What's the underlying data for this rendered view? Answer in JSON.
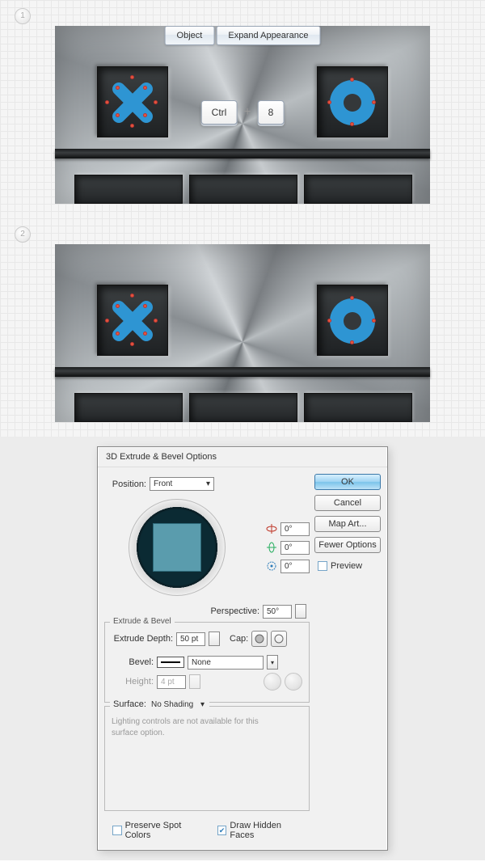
{
  "step1": {
    "badge": "1"
  },
  "step2": {
    "badge": "2"
  },
  "menu": {
    "object": "Object",
    "expand_appearance": "Expand Appearance"
  },
  "shortcut": {
    "key_ctrl": "Ctrl",
    "plus": "+",
    "key_8": "8"
  },
  "dialog": {
    "title": "3D Extrude & Bevel Options",
    "position_label": "Position:",
    "position_value": "Front",
    "rot_x": "0°",
    "rot_y": "0°",
    "rot_z": "0°",
    "perspective_label": "Perspective:",
    "perspective_value": "50°",
    "section_extrude": "Extrude & Bevel",
    "extrude_depth_label": "Extrude Depth:",
    "extrude_depth_value": "50 pt",
    "cap_label": "Cap:",
    "bevel_label": "Bevel:",
    "bevel_value": "None",
    "height_label": "Height:",
    "height_value": "4 pt",
    "surface_label": "Surface:",
    "surface_value": "No Shading",
    "lighting_note": "Lighting controls are not available for this surface option.",
    "preserve_spot": "Preserve Spot Colors",
    "draw_hidden": "Draw Hidden Faces",
    "buttons": {
      "ok": "OK",
      "cancel": "Cancel",
      "map_art": "Map Art...",
      "fewer_options": "Fewer Options",
      "preview": "Preview"
    }
  }
}
